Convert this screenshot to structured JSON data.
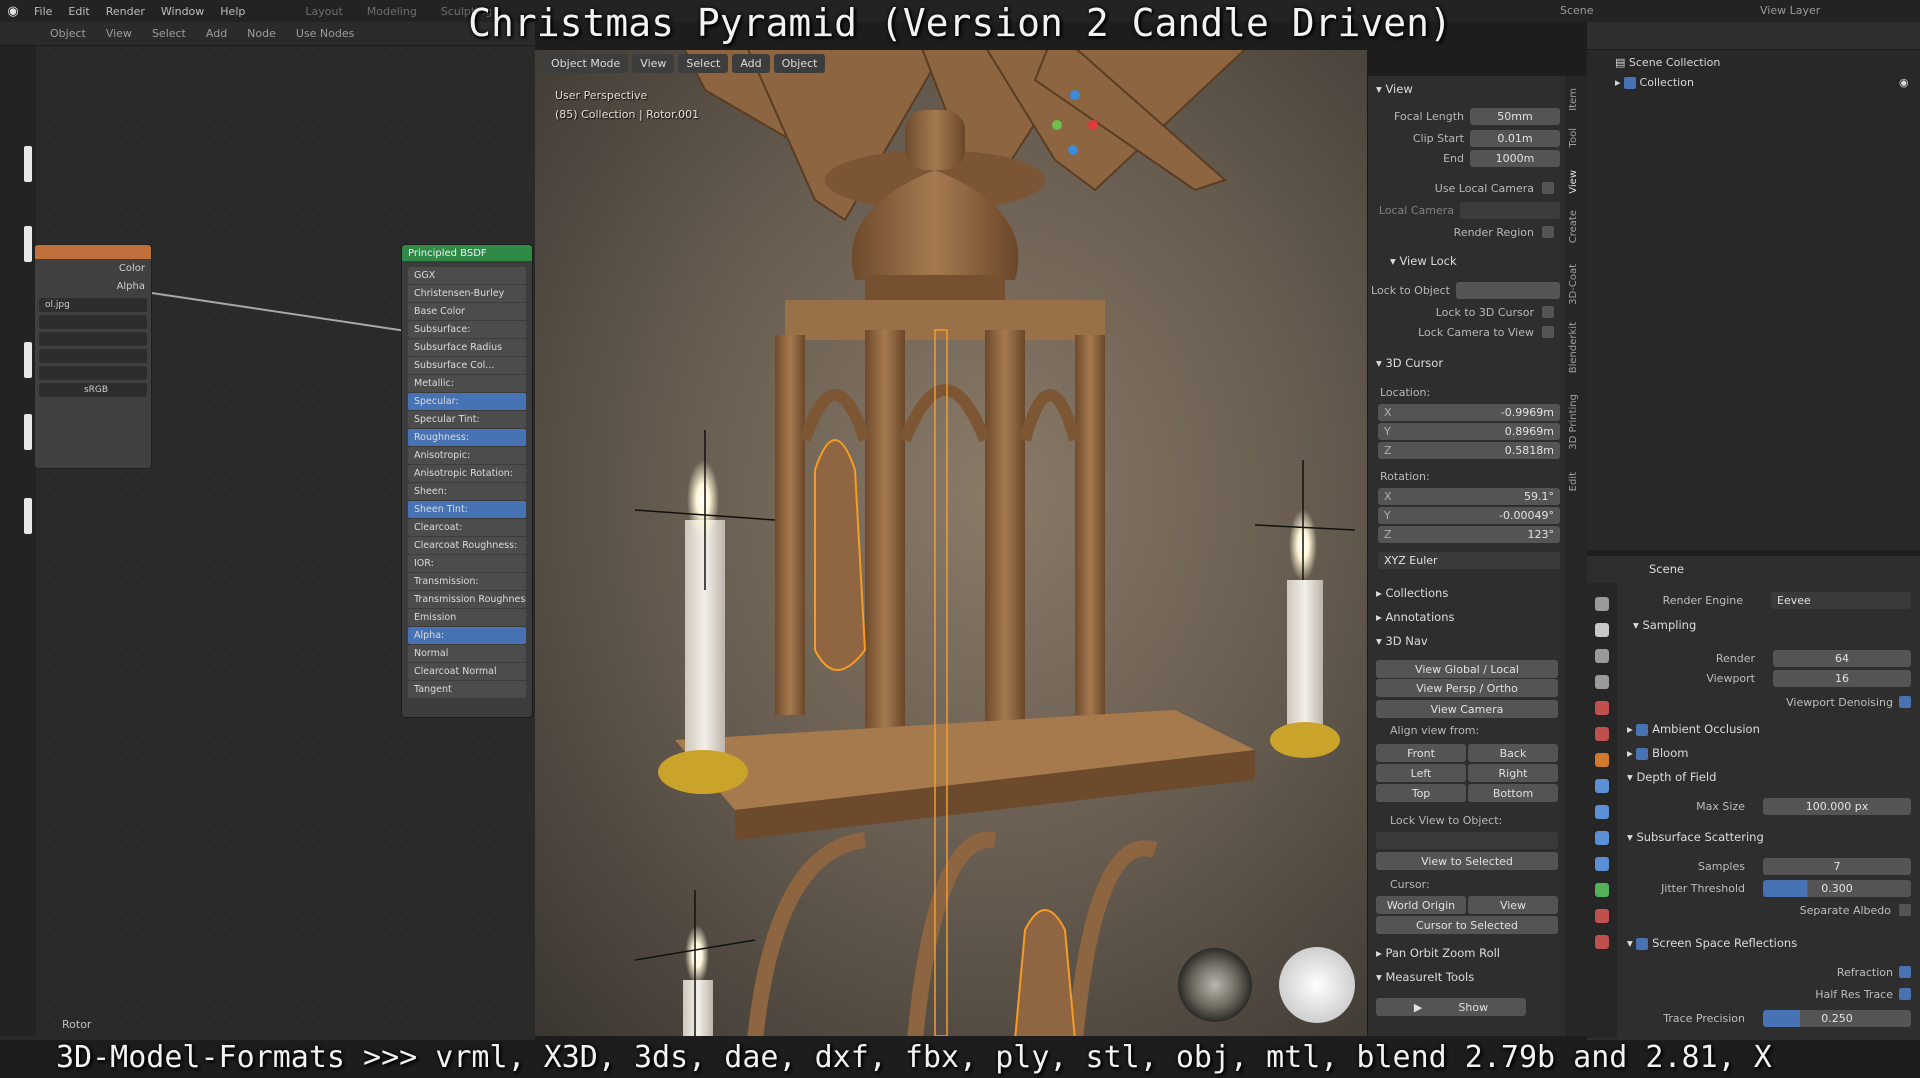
{
  "overlay": {
    "title": "Christmas Pyramid (Version 2 Candle Driven)",
    "bottom_caption": "3D-Model-Formats >>> vrml, X3D, 3ds, dae, dxf, fbx, ply, stl, obj, mtl, blend 2.79b and 2.81, X"
  },
  "topbar": {
    "menus": [
      "File",
      "Edit",
      "Render",
      "Window",
      "Help"
    ],
    "workspaces": [
      "Layout",
      "Modeling",
      "Sculpting"
    ],
    "scene": "Scene",
    "view_layer": "View Layer"
  },
  "node_editor": {
    "header_items": [
      "Object",
      "View",
      "Select",
      "Add",
      "Node",
      "Use Nodes"
    ],
    "image_node": {
      "outputs": [
        "Color",
        "Alpha"
      ],
      "image_name": "ol.jpg",
      "color_space": "sRGB"
    },
    "bsdf": {
      "title": "Principled BSDF",
      "distribution": "GGX",
      "subsurface_method": "Christensen-Burley",
      "inputs": [
        {
          "label": "Base Color",
          "hl": false
        },
        {
          "label": "Subsurface:",
          "hl": false
        },
        {
          "label": "Subsurface Radius",
          "hl": false
        },
        {
          "label": "Subsurface Col...",
          "hl": false
        },
        {
          "label": "Metallic:",
          "hl": false
        },
        {
          "label": "Specular:",
          "hl": true
        },
        {
          "label": "Specular Tint:",
          "hl": false
        },
        {
          "label": "Roughness:",
          "hl": true
        },
        {
          "label": "Anisotropic:",
          "hl": false
        },
        {
          "label": "Anisotropic Rotation:",
          "hl": false
        },
        {
          "label": "Sheen:",
          "hl": false
        },
        {
          "label": "Sheen Tint:",
          "hl": true
        },
        {
          "label": "Clearcoat:",
          "hl": false
        },
        {
          "label": "Clearcoat Roughness:",
          "hl": false
        },
        {
          "label": "IOR:",
          "hl": false
        },
        {
          "label": "Transmission:",
          "hl": false
        },
        {
          "label": "Transmission Roughness",
          "hl": false
        },
        {
          "label": "Emission",
          "hl": false
        },
        {
          "label": "Alpha:",
          "hl": true
        },
        {
          "label": "Normal",
          "hl": false
        },
        {
          "label": "Clearcoat Normal",
          "hl": false
        },
        {
          "label": "Tangent",
          "hl": false
        }
      ]
    },
    "footer_label": "Rotor"
  },
  "viewport": {
    "header_buttons": [
      "Object Mode",
      "View",
      "Select",
      "Add",
      "Object"
    ],
    "info_line1": "User Perspective",
    "info_line2": "(85) Collection | Rotor.001"
  },
  "npanel": {
    "tabs": [
      "Item",
      "Tool",
      "View",
      "Create",
      "3D-Coat",
      "Blenderkit",
      "3D Printing",
      "Edit"
    ],
    "view": {
      "title": "View",
      "focal_length_label": "Focal Length",
      "focal_length": "50mm",
      "clip_start_label": "Clip Start",
      "clip_start": "0.01m",
      "end_label": "End",
      "end": "1000m",
      "use_local_camera": "Use Local Camera",
      "local_camera": "Local Camera",
      "render_region": "Render Region"
    },
    "view_lock": {
      "title": "View Lock",
      "lock_to_object": "Lock to Object",
      "lock_to_cursor": "Lock to 3D Cursor",
      "lock_camera": "Lock Camera to View"
    },
    "cursor": {
      "title": "3D Cursor",
      "location_label": "Location:",
      "x": "-0.9969m",
      "y": "0.8969m",
      "z": "0.5818m",
      "rotation_label": "Rotation:",
      "rx": "59.1°",
      "ry": "-0.00049°",
      "rz": "123°",
      "mode": "XYZ Euler"
    },
    "collapsed": [
      "Collections",
      "Annotations"
    ],
    "nav": {
      "title": "3D Nav",
      "view_global": "View Global / Local",
      "view_persp": "View Persp / Ortho",
      "view_camera": "View Camera",
      "align_from": "Align view from:",
      "front": "Front",
      "back": "Back",
      "left": "Left",
      "right": "Right",
      "top": "Top",
      "bottom": "Bottom",
      "lock_view": "Lock View to Object:",
      "view_selected": "View to Selected",
      "cursor_label": "Cursor:",
      "world_origin": "World Origin",
      "view": "View",
      "cursor_to_selected": "Cursor to Selected"
    },
    "pan_orbit": "Pan Orbit Zoom Roll",
    "measureit": "MeasureIt Tools",
    "show": "Show"
  },
  "outliner": {
    "scene_collection": "Scene Collection",
    "collection": "Collection"
  },
  "properties": {
    "scene": "Scene",
    "render_engine_label": "Render Engine",
    "render_engine": "Eevee",
    "sampling": "Sampling",
    "render_label": "Render",
    "render": "64",
    "viewport_label": "Viewport",
    "viewport": "16",
    "denoise": "Viewport Denoising",
    "ao": "Ambient Occlusion",
    "bloom": "Bloom",
    "dof": "Depth of Field",
    "max_size_label": "Max Size",
    "max_size": "100.000 px",
    "sss": "Subsurface Scattering",
    "samples_label": "Samples",
    "samples": "7",
    "jitter_label": "Jitter Threshold",
    "jitter": "0.300",
    "sep_albedo": "Separate Albedo",
    "ssr": "Screen Space Reflections",
    "refraction": "Refraction",
    "half_res": "Half Res Trace",
    "trace_label": "Trace Precision",
    "trace": "0.250"
  },
  "colors": {
    "accent": "#4772b3",
    "bsdf_header": "#2f8a48",
    "image_header": "#c0703a"
  }
}
